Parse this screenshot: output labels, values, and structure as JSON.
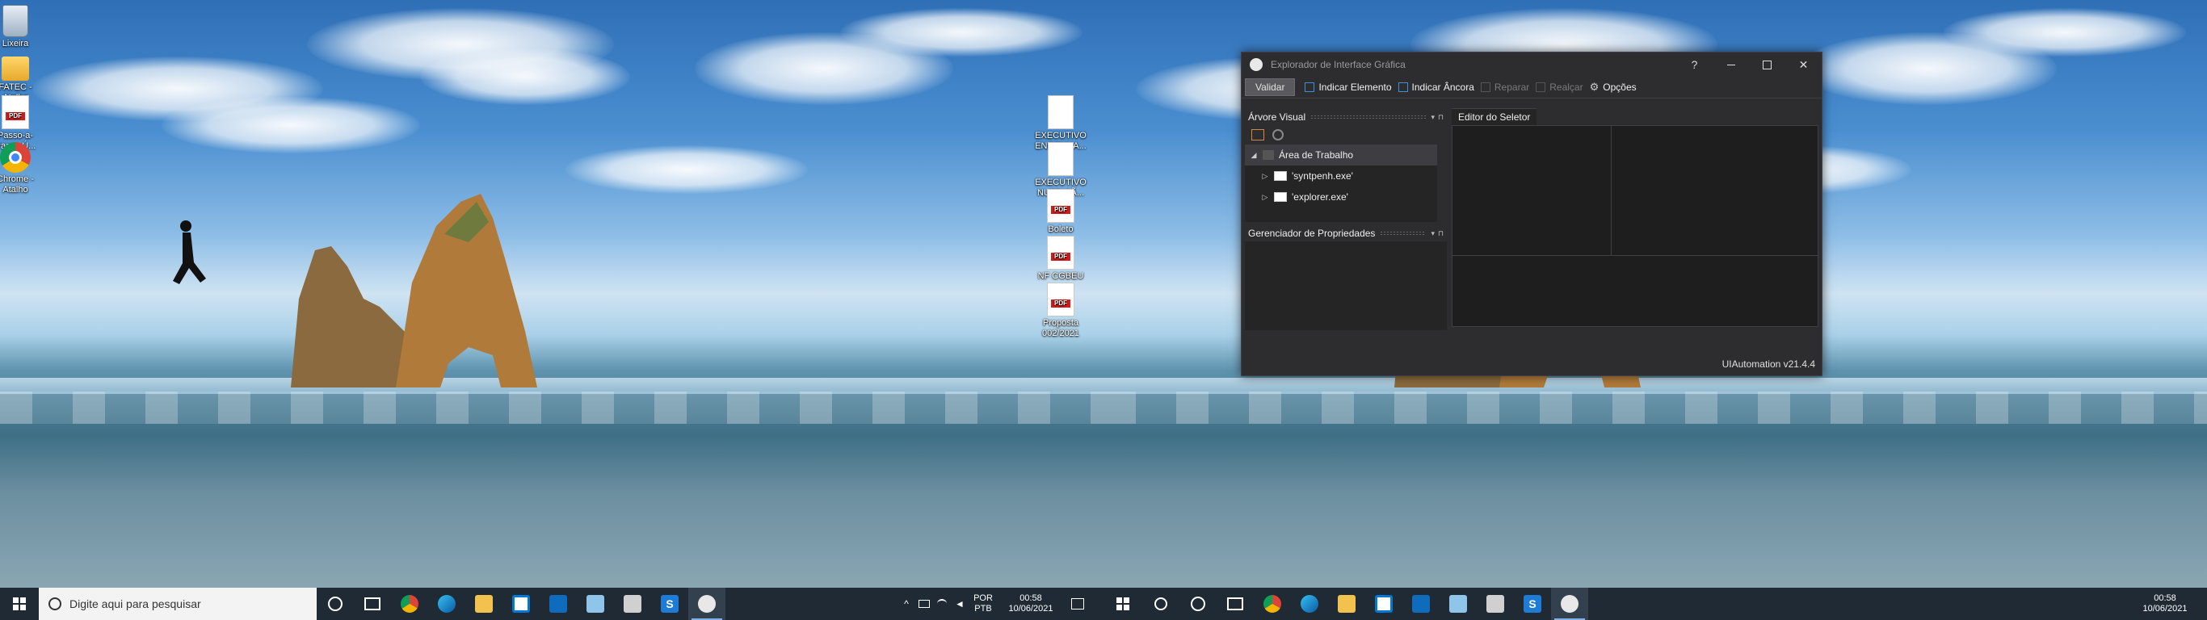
{
  "desktop_left": {
    "icons": [
      {
        "label": "Lixeira",
        "icon": "recycle-bin-icon"
      },
      {
        "label": "FATEC - Atalho",
        "icon": "folder-icon"
      },
      {
        "label": "Passo-a-Passo Ú...",
        "icon": "pdf-icon"
      },
      {
        "label": "Chrome - Atalho",
        "icon": "chrome-icon"
      },
      {
        "label": "EXECUTIVO ENGENHA...",
        "icon": "document-icon"
      },
      {
        "label": "EXECUTIVO NUTRIÇÃ...",
        "icon": "document-icon"
      },
      {
        "label": "Boleto",
        "icon": "pdf-icon"
      },
      {
        "label": "NF CGBEU",
        "icon": "pdf-icon"
      },
      {
        "label": "Proposta 002/2021",
        "icon": "pdf-icon"
      }
    ]
  },
  "taskbar_left": {
    "search_placeholder": "Digite aqui para pesquisar",
    "language": "POR",
    "layout": "PTB",
    "time": "00:58",
    "date": "10/06/2021"
  },
  "taskbar_right": {
    "time": "00:58",
    "date": "10/06/2021"
  },
  "pdf_badge": "PDF",
  "window": {
    "title": "Explorador de Interface Gráfica",
    "help": "?",
    "toolbar": {
      "validar": "Validar",
      "indicar_elemento": "Indicar Elemento",
      "indicar_ancora": "Indicar Âncora",
      "reparar": "Reparar",
      "realcar": "Realçar",
      "opcoes": "Opções"
    },
    "arvore_visual": {
      "title": "Árvore Visual",
      "items": [
        {
          "label": "Área de Trabalho"
        },
        {
          "label": "'syntpenh.exe'"
        },
        {
          "label": "'explorer.exe'"
        }
      ]
    },
    "gerenciador": {
      "title": "Gerenciador de Propriedades"
    },
    "editor": {
      "tab": "Editor do Seletor"
    },
    "status": "UIAutomation v21.4.4"
  },
  "colors": {
    "taskbar": "#1f2a35",
    "window_bg": "#2d2d30",
    "active_underline": "#7fb3e8"
  }
}
